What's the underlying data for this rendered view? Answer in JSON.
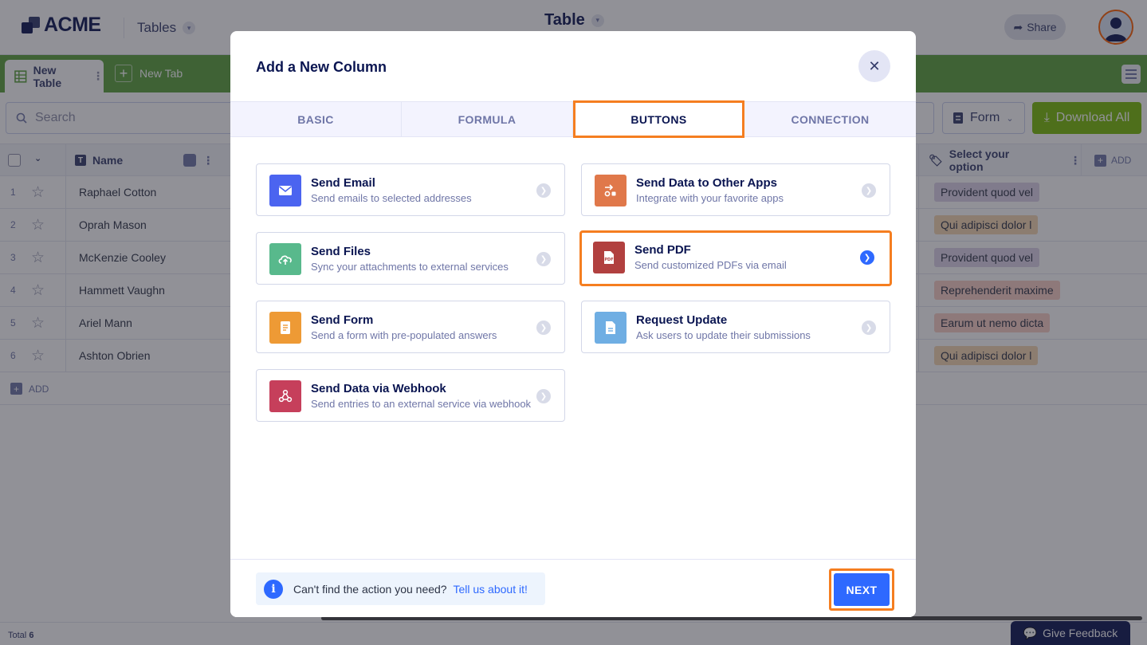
{
  "app": {
    "logo": "ACME",
    "tables_menu": "Tables",
    "title": "Table",
    "share": "Share"
  },
  "tabs": {
    "active": "New Table",
    "new": "New Tab"
  },
  "toolbar": {
    "search_placeholder": "Search",
    "form": "Form",
    "download_all": "Download All"
  },
  "grid": {
    "name_header": "Name",
    "option_header": "Select your option",
    "add_col": "ADD",
    "add_row": "ADD",
    "rows": [
      {
        "num": "1",
        "name": "Raphael Cotton",
        "option": "Provident quod vel",
        "chip": "#dcd3e8"
      },
      {
        "num": "2",
        "name": "Oprah Mason",
        "option": "Qui adipisci dolor l",
        "chip": "#f5d6b1"
      },
      {
        "num": "3",
        "name": "McKenzie Cooley",
        "option": "Provident quod vel",
        "chip": "#dcd3e8"
      },
      {
        "num": "4",
        "name": "Hammett Vaughn",
        "option": "Reprehenderit maxime",
        "chip": "#f8cfc5"
      },
      {
        "num": "5",
        "name": "Ariel Mann",
        "option": "Earum ut nemo dicta",
        "chip": "#f8cfc5"
      },
      {
        "num": "6",
        "name": "Ashton Obrien",
        "option": "Qui adipisci dolor l",
        "chip": "#f5d6b1"
      }
    ],
    "total_label": "Total",
    "total_value": "6"
  },
  "feedback": "Give Feedback",
  "modal": {
    "title": "Add a New Column",
    "tabs": [
      "BASIC",
      "FORMULA",
      "BUTTONS",
      "CONNECTION"
    ],
    "active_tab": "BUTTONS",
    "cards": [
      {
        "title": "Send Email",
        "desc": "Send emails to selected addresses",
        "icon": "envelope-icon",
        "color": "#4b64f0"
      },
      {
        "title": "Send Data to Other Apps",
        "desc": "Integrate with your favorite apps",
        "icon": "integration-icon",
        "color": "#e0784a"
      },
      {
        "title": "Send Files",
        "desc": "Sync your attachments to external services",
        "icon": "cloud-upload-icon",
        "color": "#58b98c"
      },
      {
        "title": "Send PDF",
        "desc": "Send customized PDFs via email",
        "icon": "pdf-icon",
        "color": "#b1403f",
        "selected": true
      },
      {
        "title": "Send Form",
        "desc": "Send a form with pre-populated answers",
        "icon": "form-icon",
        "color": "#ee9a35"
      },
      {
        "title": "Request Update",
        "desc": "Ask users to update their submissions",
        "icon": "document-icon",
        "color": "#6faee3"
      },
      {
        "title": "Send Data via Webhook",
        "desc": "Send entries to an external service via webhook",
        "icon": "webhook-icon",
        "color": "#c63f5b"
      }
    ],
    "hint_text": "Can't find the action you need?",
    "hint_link": "Tell us about it!",
    "next": "NEXT"
  },
  "colors": {
    "accent_blue": "#2e69ff",
    "highlight_orange": "#f57e20",
    "tab_green": "#5aa03b",
    "download_green": "#78bb07",
    "navy": "#0a1551"
  }
}
